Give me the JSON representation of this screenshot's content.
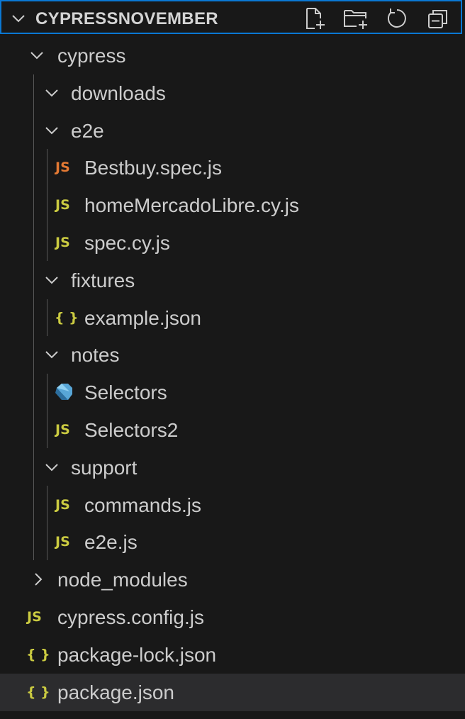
{
  "explorer": {
    "title": "CYPRESSNOVEMBER",
    "actions": [
      {
        "name": "new-file-button",
        "icon": "new-file-icon"
      },
      {
        "name": "new-folder-button",
        "icon": "new-folder-icon"
      },
      {
        "name": "refresh-button",
        "icon": "refresh-icon"
      },
      {
        "name": "collapse-all-button",
        "icon": "collapse-all-icon"
      }
    ],
    "colors": {
      "background": "#181818",
      "focus_border": "#0a78d4",
      "selected_row": "#2c2c2e",
      "js_icon": "#cbcb41",
      "js_icon_alt": "#e37933",
      "json_icon": "#cbcb41",
      "text": "#cccccc"
    }
  },
  "tree": {
    "cypress": "cypress",
    "downloads": "downloads",
    "e2e": "e2e",
    "bestbuy": "Bestbuy.spec.js",
    "homeMercado": "homeMercadoLibre.cy.js",
    "spec": "spec.cy.js",
    "fixtures": "fixtures",
    "example": "example.json",
    "notes": "notes",
    "selectors": "Selectors",
    "selectors2": "Selectors2",
    "support": "support",
    "commands": "commands.js",
    "e2e_js": "e2e.js",
    "node_modules": "node_modules",
    "cypress_config": "cypress.config.js",
    "package_lock": "package-lock.json",
    "package_json": "package.json"
  },
  "icons": {
    "js_glyph": "JS",
    "json_glyph": "{ }"
  }
}
